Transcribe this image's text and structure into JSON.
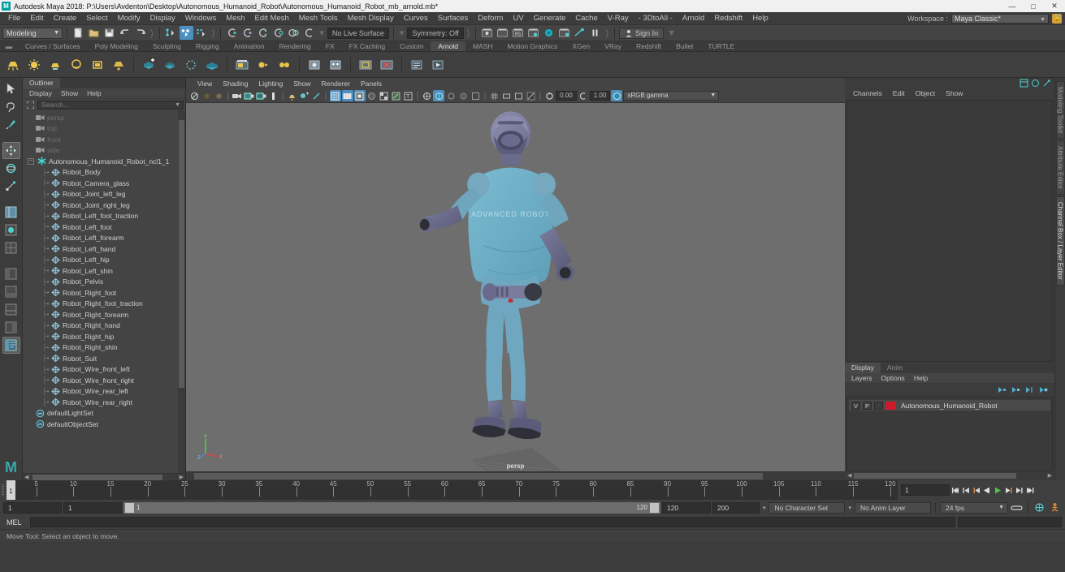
{
  "window": {
    "title": "Autodesk Maya 2018: P:\\Users\\Avdenton\\Desktop\\Autonomous_Humanoid_Robot\\Autonomous_Humanoid_Robot_mb_arnold.mb*",
    "app_badge": "M",
    "minimize": "—",
    "maximize": "□",
    "close": "✕"
  },
  "menubar": {
    "items": [
      "File",
      "Edit",
      "Create",
      "Select",
      "Modify",
      "Display",
      "Windows",
      "Mesh",
      "Edit Mesh",
      "Mesh Tools",
      "Mesh Display",
      "Curves",
      "Surfaces",
      "Deform",
      "UV",
      "Generate",
      "Cache",
      "V-Ray",
      "- 3DtoAll -",
      "Arnold",
      "Redshift",
      "Help"
    ],
    "workspace_label": "Workspace :",
    "workspace_value": "Maya Classic*"
  },
  "statusbar": {
    "mode": "Modeling",
    "live_surface": "No Live Surface",
    "symmetry": "Symmetry: Off",
    "signin": "Sign In"
  },
  "shelf": {
    "tabs": [
      "Curves / Surfaces",
      "Poly Modeling",
      "Sculpting",
      "Rigging",
      "Animation",
      "Rendering",
      "FX",
      "FX Caching",
      "Custom",
      "Arnold",
      "MASH",
      "Motion Graphics",
      "XGen",
      "VRay",
      "Redshift",
      "Bullet",
      "TURTLE"
    ],
    "active_tab": "Arnold"
  },
  "outliner": {
    "tab": "Outliner",
    "menu": [
      "Display",
      "Show",
      "Help"
    ],
    "search_placeholder": "Search...",
    "items": [
      {
        "label": "persp",
        "icon": "camera-icon",
        "depth": 1,
        "dim": true
      },
      {
        "label": "top",
        "icon": "camera-icon",
        "depth": 1,
        "dim": true
      },
      {
        "label": "front",
        "icon": "camera-icon",
        "depth": 1,
        "dim": true
      },
      {
        "label": "side",
        "icon": "camera-icon",
        "depth": 1,
        "dim": true
      },
      {
        "label": "Autonomous_Humanoid_Robot_ncl1_1",
        "icon": "asterisk-icon",
        "depth": 0,
        "dim": false,
        "expander": true
      },
      {
        "label": "Robot_Body",
        "icon": "mesh-icon",
        "depth": 2,
        "dim": false
      },
      {
        "label": "Robot_Camera_glass",
        "icon": "mesh-icon",
        "depth": 2,
        "dim": false
      },
      {
        "label": "Robot_Joint_left_leg",
        "icon": "mesh-icon",
        "depth": 2,
        "dim": false
      },
      {
        "label": "Robot_Joint_right_leg",
        "icon": "mesh-icon",
        "depth": 2,
        "dim": false
      },
      {
        "label": "Robot_Left_foot_traction",
        "icon": "mesh-icon",
        "depth": 2,
        "dim": false
      },
      {
        "label": "Robot_Left_foot",
        "icon": "mesh-icon",
        "depth": 2,
        "dim": false
      },
      {
        "label": "Robot_Left_forearm",
        "icon": "mesh-icon",
        "depth": 2,
        "dim": false
      },
      {
        "label": "Robot_Left_hand",
        "icon": "mesh-icon",
        "depth": 2,
        "dim": false
      },
      {
        "label": "Robot_Left_hip",
        "icon": "mesh-icon",
        "depth": 2,
        "dim": false
      },
      {
        "label": "Robot_Left_shin",
        "icon": "mesh-icon",
        "depth": 2,
        "dim": false
      },
      {
        "label": "Robot_Pelvis",
        "icon": "mesh-icon",
        "depth": 2,
        "dim": false
      },
      {
        "label": "Robot_Right_foot",
        "icon": "mesh-icon",
        "depth": 2,
        "dim": false
      },
      {
        "label": "Robot_Right_foot_traction",
        "icon": "mesh-icon",
        "depth": 2,
        "dim": false
      },
      {
        "label": "Robot_Right_forearm",
        "icon": "mesh-icon",
        "depth": 2,
        "dim": false
      },
      {
        "label": "Robot_Right_hand",
        "icon": "mesh-icon",
        "depth": 2,
        "dim": false
      },
      {
        "label": "Robot_Right_hip",
        "icon": "mesh-icon",
        "depth": 2,
        "dim": false
      },
      {
        "label": "Robot_Right_shin",
        "icon": "mesh-icon",
        "depth": 2,
        "dim": false
      },
      {
        "label": "Robot_Suit",
        "icon": "mesh-icon",
        "depth": 2,
        "dim": false
      },
      {
        "label": "Robot_Wire_front_left",
        "icon": "mesh-icon",
        "depth": 2,
        "dim": false
      },
      {
        "label": "Robot_Wire_front_right",
        "icon": "mesh-icon",
        "depth": 2,
        "dim": false
      },
      {
        "label": "Robot_Wire_rear_left",
        "icon": "mesh-icon",
        "depth": 2,
        "dim": false
      },
      {
        "label": "Robot_Wire_rear_right",
        "icon": "mesh-icon",
        "depth": 2,
        "dim": false
      },
      {
        "label": "defaultLightSet",
        "icon": "set-icon",
        "depth": 1,
        "dim": false
      },
      {
        "label": "defaultObjectSet",
        "icon": "set-icon",
        "depth": 1,
        "dim": false
      }
    ]
  },
  "viewport": {
    "menu": [
      "View",
      "Shading",
      "Lighting",
      "Show",
      "Renderer",
      "Panels"
    ],
    "exposure": "0.00",
    "gamma_value": "1.00",
    "color_space": "sRGB gamma",
    "camera_label": "persp",
    "axis_labels": {
      "y": "Y",
      "x": "X",
      "z": "Z"
    }
  },
  "channelbox": {
    "menu": [
      "Channels",
      "Edit",
      "Object",
      "Show"
    ]
  },
  "layereditor": {
    "tabs": [
      "Display",
      "Anim"
    ],
    "active_tab": "Display",
    "menu": [
      "Layers",
      "Options",
      "Help"
    ],
    "columns": [
      "V",
      "P"
    ],
    "layers": [
      {
        "visible": "V",
        "playback": "P",
        "color": "#cc1a2a",
        "name": "Autonomous_Humanoid_Robot"
      }
    ]
  },
  "right_tabs": [
    "Modeling Toolkit",
    "Attribute Editor",
    "Channel Box / Layer Editor"
  ],
  "timeline": {
    "labels": [
      "5",
      "10",
      "15",
      "20",
      "25",
      "30",
      "35",
      "40",
      "45",
      "50",
      "55",
      "60",
      "65",
      "70",
      "75",
      "80",
      "85",
      "90",
      "95",
      "100",
      "105",
      "110",
      "115",
      "120"
    ],
    "current_frame": "1",
    "playhead_frame": "1",
    "start": 1,
    "end": 120
  },
  "rangebar": {
    "anim_start": "1",
    "range_start": "1",
    "slider_left_label": "1",
    "slider_right_label": "120",
    "range_end": "120",
    "anim_end": "200",
    "character_set": "No Character Set",
    "anim_layer": "No Anim Layer",
    "fps": "24 fps"
  },
  "command": {
    "language": "MEL",
    "input_value": "",
    "status": "Move Tool: Select an object to move."
  }
}
